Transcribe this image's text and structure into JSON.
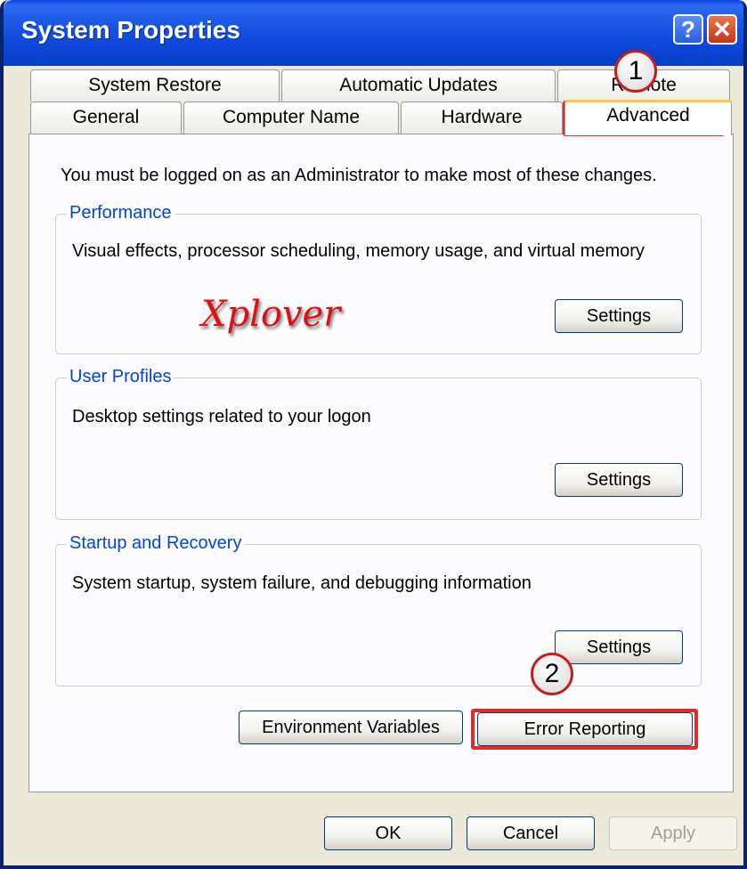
{
  "window": {
    "title": "System Properties"
  },
  "title_buttons": {
    "help_glyph": "?",
    "close_glyph": "✕"
  },
  "tabs": {
    "row1": [
      {
        "label": "System Restore"
      },
      {
        "label": "Automatic Updates"
      },
      {
        "label": "Remote"
      }
    ],
    "row2": [
      {
        "label": "General"
      },
      {
        "label": "Computer Name"
      },
      {
        "label": "Hardware"
      },
      {
        "label": "Advanced",
        "selected": true
      }
    ]
  },
  "advanced": {
    "admin_notice": "You must be logged on as an Administrator to make most of these changes.",
    "performance": {
      "title": "Performance",
      "description": "Visual effects, processor scheduling, memory usage, and virtual memory",
      "button": "Settings"
    },
    "user_profiles": {
      "title": "User Profiles",
      "description": "Desktop settings related to your logon",
      "button": "Settings"
    },
    "startup_recovery": {
      "title": "Startup and Recovery",
      "description": "System startup, system failure, and debugging information",
      "button": "Settings"
    },
    "environment_variables": "Environment Variables",
    "error_reporting": "Error Reporting"
  },
  "footer": {
    "ok": "OK",
    "cancel": "Cancel",
    "apply": "Apply"
  },
  "annotations": {
    "marker1": "1",
    "marker2": "2",
    "watermark": "Xplover"
  },
  "colors": {
    "title_bar": "#0A3FE0",
    "callout": "#E42B2B",
    "group_title": "#0046D5"
  }
}
